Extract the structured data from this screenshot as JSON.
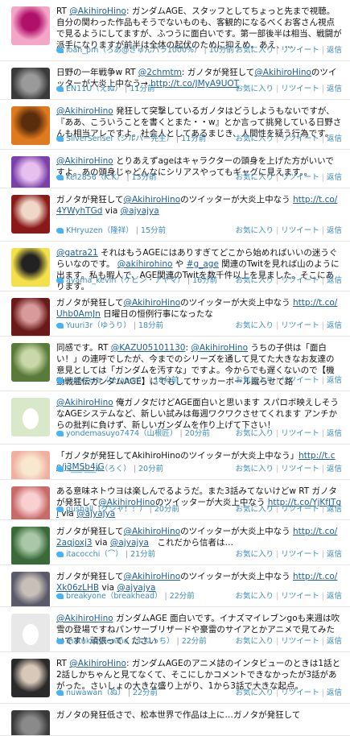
{
  "actions": {
    "fav": "お気に入り",
    "rt": "リツイート",
    "reply": "返信",
    "sep": "|"
  },
  "tweets": [
    {
      "h": 76,
      "av": [
        "#f4a6c6",
        "#b0106a"
      ],
      "segs": [
        {
          "t": "RT "
        },
        {
          "t": "@AkihiroHino",
          "k": "mention"
        },
        {
          "t": ": ガンダムAGE、スタッフとしてちょっと先まで視聴。自分の関わった作品もそうでないものも、客観的になるべくお客さん視点で見るようにしてますが、ふつうに面白いです。第一部後半は相当、戦闘が派手になりますが前半は全体の起伏のために抑えめ。あえ、…"
        }
      ],
      "user": "loah_pm（ろあ@きゅんパラ1000%）",
      "time": "10分前"
    },
    {
      "h": 48,
      "av": [
        "#3a3a3a",
        "#9a9a9a"
      ],
      "segs": [
        {
          "t": "日野の一年戦争w RT "
        },
        {
          "t": "@2chmtm",
          "k": "mention"
        },
        {
          "t": ": ガノタが発狂して"
        },
        {
          "t": "@AkihiroHino",
          "k": "mention"
        },
        {
          "t": "のツイッターが大炎上中なう→ "
        },
        {
          "t": "http://t.co/JMyA9UOT",
          "k": "url"
        }
      ],
      "user": "EN11U（えぬ）",
      "time": "11分前"
    },
    {
      "h": 62,
      "av": [
        "#e07a1e",
        "#5a2d0c"
      ],
      "segs": [
        {
          "t": "@AkihiroHino",
          "k": "mention"
        },
        {
          "t": " 発狂して突撃しているガノタはどうしようもないですが、『ああ、こういうことを書くとまた・・w』とか言って挑発している日野さんも相当アレですよ。社会人としてあるまじき、人間性を疑う行為です。"
        }
      ],
      "user": "SilverSensei（シルバー先生）",
      "time": "11分前"
    },
    {
      "h": 48,
      "av": [
        "#7a3fa8",
        "#e8c0f0"
      ],
      "segs": [
        {
          "t": "@AkihiroHino",
          "k": "mention"
        },
        {
          "t": " とりあえずageはキャラクターの頭身を上げた方がいいですよ。あの頭身じゃどんなにシリアスやってもギャグに見えます。。"
        }
      ],
      "user": "kei2856（K.K）",
      "time": "13分前"
    },
    {
      "h": 66,
      "av": [
        "#8a1a1a",
        "#f0d8c8"
      ],
      "segs": [
        {
          "t": "ガノタが発狂して"
        },
        {
          "t": "@AkihiroHino",
          "k": "mention"
        },
        {
          "t": "のツイッターが大炎上中なう "
        },
        {
          "t": "http://t.co/4YWyhTGd",
          "k": "url"
        },
        {
          "t": " via "
        },
        {
          "t": "@ajyajya",
          "k": "mention"
        }
      ],
      "user": "KHryuzen（隆祥）",
      "time": "15分前"
    },
    {
      "h": 62,
      "av": [
        "#f3e04a",
        "#222222"
      ],
      "segs": [
        {
          "t": "@gatra21",
          "k": "mention"
        },
        {
          "t": " それはもうAGEにはありすぎてどこから始めればいいの迷うぐらいなのです。 "
        },
        {
          "t": "@akihirohino",
          "k": "mention"
        },
        {
          "t": " や "
        },
        {
          "t": "#g_age",
          "k": "hash"
        },
        {
          "t": " 関連のTwitを見れば山のように出ます。私も暇人で、AGE関連のTwitを数千件以上を見ました。そこにあります。"
        }
      ],
      "user": "ayama_kevin（ケビン・アヤマ）",
      "time": "16分前"
    },
    {
      "h": 56,
      "av": [
        "#6a1818",
        "#d89a9a"
      ],
      "segs": [
        {
          "t": "ガノタが発狂して"
        },
        {
          "t": "@AkihiroHino",
          "k": "mention"
        },
        {
          "t": "のツイッターが大炎上中なう "
        },
        {
          "t": "http://t.co/Uhb0AmJn",
          "k": "url"
        },
        {
          "t": " 日曜日の恒例行事になったな"
        }
      ],
      "user": "Yuuri3r（ゆうり）",
      "time": "18分前"
    },
    {
      "h": 68,
      "av": [
        "#5a7a3a",
        "#c8d8a8"
      ],
      "segs": [
        {
          "t": "同感です。RT "
        },
        {
          "t": "@KAZU05101130",
          "k": "mention"
        },
        {
          "t": ": "
        },
        {
          "t": "@AkihiroHino",
          "k": "mention"
        },
        {
          "t": " うちの子供は「面白い！」の連呼でしたが、今までのシリーズを通して見てた大きなお友達の意見としては「ガンダムを汚すな」ですよ。今からでも遅くないので【機動戦艦伝ガンダムAGE】にでもしてサッカーボール蹴らせて路"
        }
      ],
      "user": "mototera（terapon）",
      "time": "18分前"
    },
    {
      "h": 66,
      "av": [
        "#d8e8c8",
        "#ffffff"
      ],
      "egg": true,
      "segs": [
        {
          "t": "@AkihiroHino",
          "k": "mention"
        },
        {
          "t": " 俺ガノタだけどAGE面白いと思います スパロボ映えしそうなAGEシステムなど、新しい試みは毎週ワクワクさせてくれます アンチからの批判に負けず、新しいガンダムを作り上げて下さい！"
        }
      ],
      "user": "yondemasuyo7474（山根匠）",
      "time": "20分前"
    },
    {
      "h": 44,
      "av": [
        "#f0b0a0",
        "#f8e8d0"
      ],
      "segs": [
        {
          "t": "「ガノタが発狂してAkihiroHinoのツイッターが大炎上中なう」"
        },
        {
          "t": "http://t.co/j3MSb4jG",
          "k": "url"
        }
      ],
      "user": "S___i___x（ろく）",
      "time": "20分前"
    },
    {
      "h": 50,
      "av": [
        "#c86a6a",
        "#f8d0d0"
      ],
      "segs": [
        {
          "t": "ある意味ネトウヨは楽しんでるようだ。また3話みてないけどw RT ガノタが発狂して"
        },
        {
          "t": "@AkihiroHino",
          "k": "mention"
        },
        {
          "t": "のツイッターが大炎上中なう "
        },
        {
          "t": "http://t.co/YjKfJTgl",
          "k": "url"
        },
        {
          "t": " via "
        },
        {
          "t": "@ajyajya",
          "k": "mention"
        }
      ],
      "user": "gushall（グシャ！！）",
      "time": "20分前"
    },
    {
      "h": 56,
      "av": [
        "#3a6a3a",
        "#a8c8a8"
      ],
      "segs": [
        {
          "t": "ガノタが発狂して"
        },
        {
          "t": "@AkihiroHino",
          "k": "mention"
        },
        {
          "t": "のツイッターが大炎上中なう "
        },
        {
          "t": "http://t.co/2aqjoxj3",
          "k": "url"
        },
        {
          "t": " via "
        },
        {
          "t": "@ajyajya",
          "k": "mention"
        },
        {
          "t": "　これだから信者は…"
        }
      ],
      "user": "itacocchi（⌒）",
      "time": "21分前"
    },
    {
      "h": 52,
      "av": [
        "#5a5a6a",
        "#c8c0b8"
      ],
      "segs": [
        {
          "t": "ガノタが発狂して"
        },
        {
          "t": "@AkihiroHino",
          "k": "mention"
        },
        {
          "t": "のツイッターが大炎上中なう "
        },
        {
          "t": "http://t.co/Xk06zLHB",
          "k": "url"
        },
        {
          "t": " via "
        },
        {
          "t": "@ajyajya",
          "k": "mention"
        }
      ],
      "user": "breakyone（breakhead）",
      "time": "22分前"
    },
    {
      "h": 56,
      "av": [
        "#e8e8e8",
        "#ffffff"
      ],
      "egg": true,
      "segs": [
        {
          "t": "@AkihiroHino",
          "k": "mention"
        },
        {
          "t": " ガンダムAGE 面白いです。イナズマイレブンgoも来週は吹雪の登場ですねパンサーブリザードや豪雷のサイアとかアニメで見てみたいです！頑張ってください"
        }
      ],
      "user": "matukazetenma（よねっち）",
      "time": "22分前"
    },
    {
      "h": 64,
      "av": [
        "#2a2a2a",
        "#d8c8b8"
      ],
      "segs": [
        {
          "t": "RT "
        },
        {
          "t": "@AkihiroHino",
          "k": "mention"
        },
        {
          "t": ": ガンダムAGEのアニメ誌のインタビューのときは1話と2話しかちゃんと見てなくて、そこにしかコメントできなかったが3話があがった。さいしょの大きな盛り上がり、1から3話で大きな起点。"
        }
      ],
      "user": "nuwawan（ぬ）",
      "time": "22分前"
    },
    {
      "h": 40,
      "av": [
        "#3a3a3a",
        "#8a8a8a"
      ],
      "segs": [
        {
          "t": "ガノタの発狂低さで、松本世界で作品は上に…ガノタが発狂して"
        }
      ],
      "user": "",
      "time": ""
    }
  ]
}
